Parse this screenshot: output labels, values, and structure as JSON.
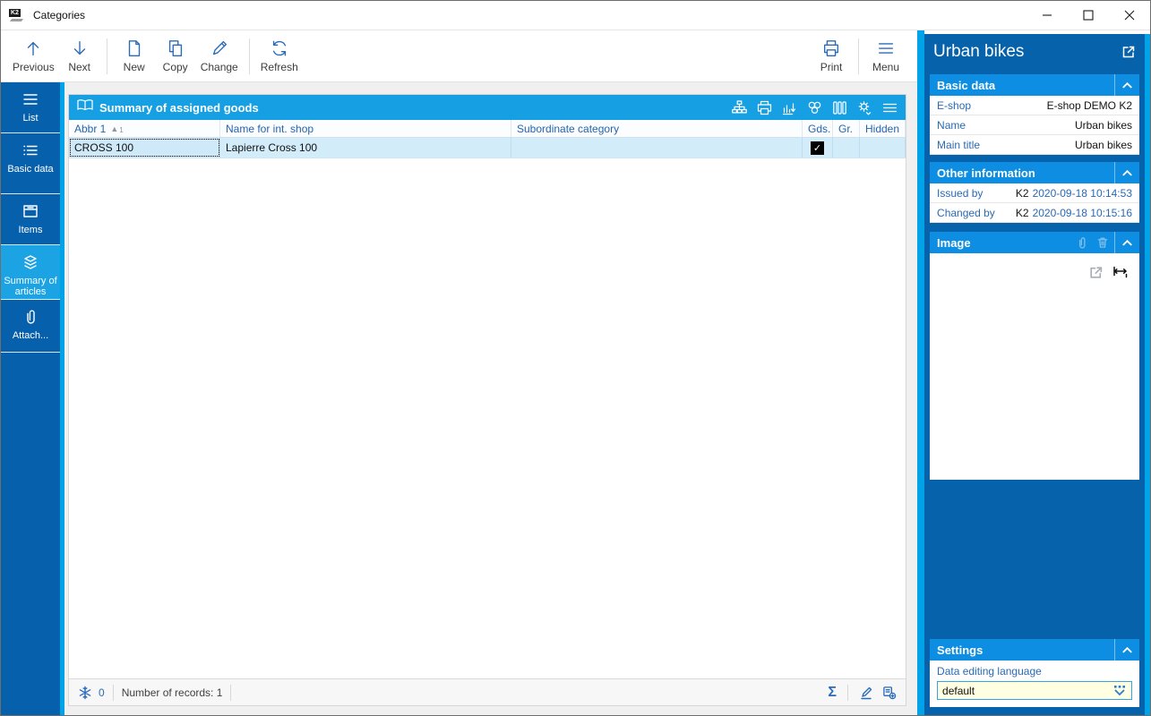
{
  "window": {
    "title": "Categories",
    "logo": "K2"
  },
  "toolbar": {
    "buttons": [
      {
        "label": "Previous"
      },
      {
        "label": "Next"
      },
      {
        "label": "New"
      },
      {
        "label": "Copy"
      },
      {
        "label": "Change"
      },
      {
        "label": "Refresh"
      },
      {
        "label": "Print"
      },
      {
        "label": "Menu"
      }
    ]
  },
  "sidebar": {
    "items": [
      {
        "label": "List",
        "active": false
      },
      {
        "label": "Basic data",
        "active": false
      },
      {
        "label": "Items",
        "active": false
      },
      {
        "label": "Summary of articles",
        "active": true
      },
      {
        "label": "Attach...",
        "active": false
      }
    ]
  },
  "table": {
    "title": "Summary of assigned goods",
    "columns": [
      "Abbr 1",
      "Name for int. shop",
      "Subordinate category",
      "Gds.",
      "Gr.",
      "Hidden"
    ],
    "sort": {
      "column": "Abbr 1",
      "direction": "asc",
      "arrow": "▲",
      "order": "1"
    },
    "rows": [
      {
        "abbr": "CROSS 100",
        "name": "Lapierre Cross 100",
        "subordinate": "",
        "gds_checked": true,
        "gr": "",
        "hidden": ""
      }
    ],
    "status": {
      "counter": "0",
      "records_label": "Number of records: 1"
    }
  },
  "right_panel": {
    "title": "Urban bikes",
    "basic_data": {
      "title": "Basic data",
      "fields": [
        {
          "label": "E-shop",
          "value": "E-shop DEMO K2"
        },
        {
          "label": "Name",
          "value": "Urban bikes"
        },
        {
          "label": "Main title",
          "value": "Urban bikes"
        }
      ]
    },
    "other_information": {
      "title": "Other information",
      "fields": [
        {
          "label": "Issued by",
          "user": "K2",
          "date": "2020-09-18 10:14:53"
        },
        {
          "label": "Changed by",
          "user": "K2",
          "date": "2020-09-18 10:15:16"
        }
      ]
    },
    "image": {
      "title": "Image"
    },
    "settings": {
      "title": "Settings",
      "language_label": "Data editing language",
      "language_value": "default"
    }
  },
  "icons": {
    "check": "✓",
    "sigma": "Σ"
  },
  "colors": {
    "dark_blue": "#0762ac",
    "bright_blue": "#00a3e8",
    "panel_title_blue": "#16a0e3",
    "section_header_blue": "#0d8ee2",
    "active_tab_blue": "#1ba3e4",
    "label_blue": "#2a69b5",
    "selection_blue": "#d3ecfa",
    "dropdown_yellow": "#ffffe1"
  }
}
